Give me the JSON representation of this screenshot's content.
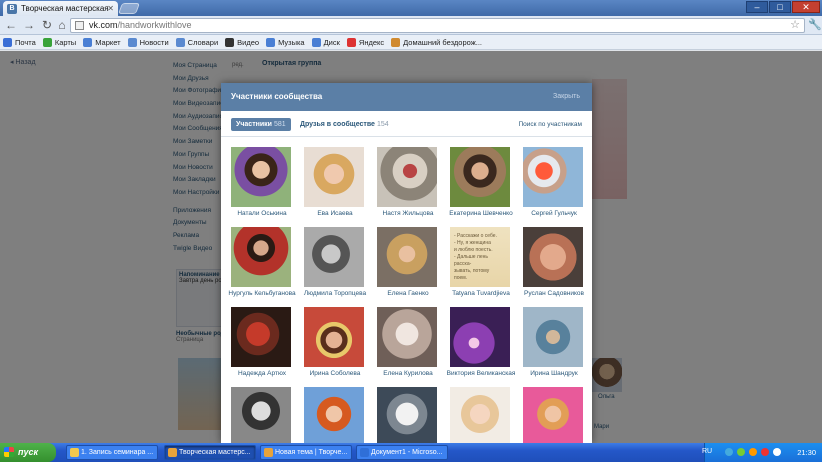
{
  "browser": {
    "tab_title": "Творческая мастерская \"Т...",
    "tab_favicon": "В",
    "url_host": "vk.com",
    "url_path": "/handworkwithlove"
  },
  "bookmarks": [
    {
      "label": "Почта",
      "color": "#3b6fd6"
    },
    {
      "label": "Карты",
      "color": "#39a33a"
    },
    {
      "label": "Маркет",
      "color": "#4a7fd4"
    },
    {
      "label": "Новости",
      "color": "#5b8ad0"
    },
    {
      "label": "Словари",
      "color": "#5b8ad0"
    },
    {
      "label": "Видео",
      "color": "#333333"
    },
    {
      "label": "Музыка",
      "color": "#4a7fd4"
    },
    {
      "label": "Диск",
      "color": "#4a7fd4"
    },
    {
      "label": "Яндекс",
      "color": "#d33"
    },
    {
      "label": "Домашний бездорож...",
      "color": "#d08a30"
    }
  ],
  "page": {
    "back_label": "Назад",
    "heading": "Открытая группа",
    "menu": [
      "Моя Страница",
      "Мои Друзья",
      "Мои Фотографии",
      "Мои Видеозаписи",
      "Мои Аудиозаписи",
      "Мои Сообщения",
      "Мои Заметки",
      "Мои Группы",
      "Мои Новости",
      "Мои Закладки",
      "Мои Настройки"
    ],
    "menu_extra": [
      "Приложения",
      "Документы",
      "Реклама",
      "Twigle Видео"
    ],
    "edit_label": "ред.",
    "reminder_title": "Напоминание",
    "reminder_text": "Завтра день рождения",
    "friends_title": "Необычные родители",
    "friends_sub": "Страница",
    "right_name_1": "Ольга",
    "right_name_2": "Мари"
  },
  "modal": {
    "title": "Участники сообщества",
    "close_label": "Закрыть",
    "tab_members": "Участники",
    "tab_members_count": "581",
    "tab_friends": "Друзья в сообществе",
    "tab_friends_count": "154",
    "search_label": "Поиск по участникам",
    "members": [
      {
        "name": "Натали Оськина",
        "icon": "avatar-woman-dark-hair"
      },
      {
        "name": "Ева Исаева",
        "icon": "avatar-woman-blonde"
      },
      {
        "name": "Настя Жильцова",
        "icon": "avatar-bike"
      },
      {
        "name": "Екатерина Шевченко",
        "icon": "avatar-woman-garden"
      },
      {
        "name": "Сергей Гульчук",
        "icon": "avatar-man-boat"
      },
      {
        "name": "Нургуль Кельбуганова",
        "icon": "avatar-woman-red-dress"
      },
      {
        "name": "Людмила Торопцева",
        "icon": "avatar-couple-bw"
      },
      {
        "name": "Елена Гаенко",
        "icon": "avatar-woman-blonde-selfie"
      },
      {
        "name": "Tatyana Tuvardjieva",
        "icon": "avatar-quote-card",
        "quote": "- Расскажи о себе.\n- Ну, я женщина\nи люблю поесть.\n- Дальше лень расска-\nзывать, потому\nпоем."
      },
      {
        "name": "Руслан Садовников",
        "icon": "avatar-hands-ring"
      },
      {
        "name": "Надежда Артюх",
        "icon": "avatar-woman-red"
      },
      {
        "name": "Ирина Соболева",
        "icon": "avatar-woman-crown"
      },
      {
        "name": "Елена Курилова",
        "icon": "avatar-blur-light"
      },
      {
        "name": "Виктория Великанская",
        "icon": "avatar-purple-flowers"
      },
      {
        "name": "Ирина Шандрук",
        "icon": "avatar-outdoor-kids"
      },
      {
        "name": "",
        "icon": "avatar-woman-bw"
      },
      {
        "name": "",
        "icon": "avatar-woman-redhead"
      },
      {
        "name": "",
        "icon": "avatar-white-tigers"
      },
      {
        "name": "",
        "icon": "avatar-woman-light"
      },
      {
        "name": "",
        "icon": "avatar-woman-pink"
      }
    ]
  },
  "taskbar": {
    "start_label": "пуск",
    "buttons": [
      {
        "label": "1. Запись семинара ...",
        "color": "#f2c94c"
      },
      {
        "label": "Творческая мастерс...",
        "color": "#e8a33a"
      },
      {
        "label": "Новая тема | Творче...",
        "color": "#e8a33a"
      },
      {
        "label": "Документ1 - Microso...",
        "color": "#2f6fd8"
      }
    ],
    "lang": "RU",
    "time": "21:30"
  }
}
